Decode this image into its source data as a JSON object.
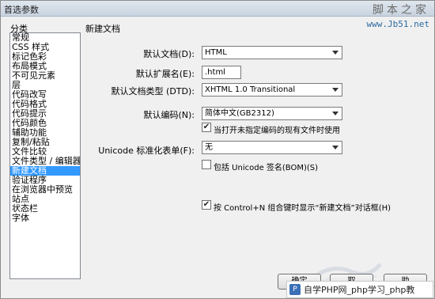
{
  "window": {
    "title": "首选参数"
  },
  "watermark": {
    "site": "脚本之家",
    "url": "www.Jb51.net"
  },
  "categories": {
    "label": "分类",
    "items": [
      "常规",
      "CSS 样式",
      "标记色彩",
      "布局模式",
      "不可见元素",
      "层",
      "代码改写",
      "代码格式",
      "代码提示",
      "代码颜色",
      "辅助功能",
      "复制/粘贴",
      "文件比较",
      "文件类型 / 编辑器",
      "新建文档",
      "验证程序",
      "在浏览器中预览",
      "站点",
      "状态栏",
      "字体"
    ],
    "selected_index": 14
  },
  "panel": {
    "title": "新建文档",
    "default_doc_label": "默认文档(D):",
    "default_doc_value": "HTML",
    "default_ext_label": "默认扩展名(E):",
    "default_ext_value": ".html",
    "default_doctype_label": "默认文档类型 (DTD):",
    "default_doctype_value": "XHTML 1.0 Transitional",
    "default_encoding_label": "默认编码(N):",
    "default_encoding_value": "简体中文(GB2312)",
    "encoding_checkbox_label": "当打开未指定编码的现有文件时使用",
    "encoding_checkbox_checked": true,
    "unicode_label": "Unicode 标准化表单(F):",
    "unicode_value": "无",
    "bom_checkbox_label": "包括 Unicode 签名(BOM)(S)",
    "bom_checkbox_checked": false,
    "ctrl_n_checkbox_label": "按 Control+N 组合键时显示“新建文档”对话框(H)",
    "ctrl_n_checkbox_checked": true
  },
  "buttons": {
    "ok": "确定",
    "cancel": "取",
    "help": "助"
  },
  "banner": {
    "icon": "php-icon",
    "text": "自学PHP网_php学习_php教"
  }
}
